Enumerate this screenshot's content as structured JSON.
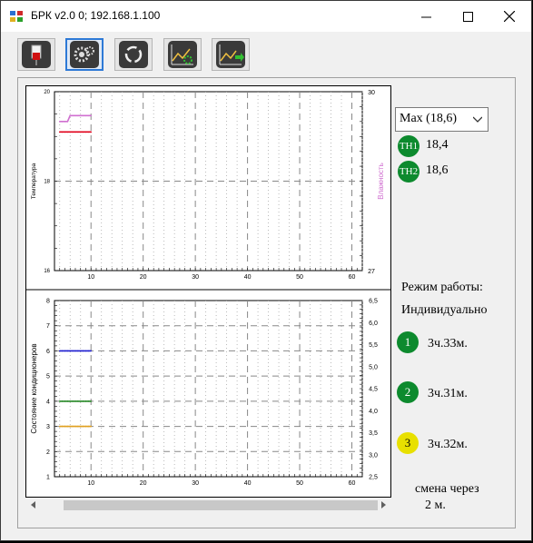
{
  "window": {
    "title": "БРК v2.0 0; 192.168.1.100",
    "controls": [
      "minimize",
      "maximize",
      "close"
    ]
  },
  "toolbar": {
    "buttons": [
      {
        "icon": "device-icon",
        "active": false
      },
      {
        "icon": "gears-icon",
        "active": true
      },
      {
        "icon": "cycle-arrows-icon",
        "active": false
      },
      {
        "icon": "chart-settings-icon",
        "active": false
      },
      {
        "icon": "chart-export-icon",
        "active": false
      }
    ]
  },
  "right_panel": {
    "select": {
      "value": "Max (18,6)"
    },
    "sensors": [
      {
        "badge": "TH1",
        "value": "18,4"
      },
      {
        "badge": "TH2",
        "value": "18,6"
      }
    ],
    "mode_label": "Режим работы:",
    "mode_value": "Индивидуально",
    "units": [
      {
        "num": "1",
        "time": "3ч.33м.",
        "color": "#0d8a2e"
      },
      {
        "num": "2",
        "time": "3ч.31м.",
        "color": "#0d8a2e"
      },
      {
        "num": "3",
        "time": "3ч.32м.",
        "color": "#e8e000"
      }
    ],
    "switch_label": "смена через",
    "switch_value": "2 м."
  },
  "chart_data": [
    {
      "type": "line",
      "ylabel": "Температура",
      "ylabel_right": "Влажность",
      "ylim": [
        16,
        20
      ],
      "ylim_right": [
        27,
        30
      ],
      "xlim": [
        3,
        62
      ],
      "xticks": [
        10,
        20,
        30,
        40,
        50,
        60
      ],
      "yticks_left": [
        "20",
        "18",
        "16"
      ],
      "yticks_right": [
        "30",
        "27"
      ],
      "grid": true,
      "series": [
        {
          "color": "#e0001a",
          "axis": "left",
          "points": [
            [
              4,
              19.1
            ],
            [
              10,
              19.1
            ]
          ]
        },
        {
          "color": "#d070d0",
          "axis": "right",
          "points": [
            [
              4,
              29.5
            ],
            [
              5.5,
              29.5
            ],
            [
              6,
              29.6
            ],
            [
              10,
              29.6
            ]
          ]
        }
      ]
    },
    {
      "type": "line",
      "ylabel": "Состояние кондиционеров",
      "ylim": [
        1,
        8
      ],
      "ylim_right": [
        2.5,
        6.5
      ],
      "xlim": [
        3,
        62
      ],
      "xticks": [
        10,
        20,
        30,
        40,
        50,
        60
      ],
      "yticks_left": [
        "1",
        "2",
        "3",
        "4",
        "5",
        "6",
        "7",
        "8"
      ],
      "yticks_right": [
        "2,5",
        "3,0",
        "3,5",
        "4,0",
        "4,5",
        "5,0",
        "5,5",
        "6,0",
        "6,5"
      ],
      "grid": true,
      "series": [
        {
          "color": "#1f1fd0",
          "axis": "left",
          "points": [
            [
              4,
              6
            ],
            [
              10,
              6
            ]
          ]
        },
        {
          "color": "#2a8a2a",
          "axis": "left",
          "points": [
            [
              4,
              4
            ],
            [
              10,
              4
            ]
          ]
        },
        {
          "color": "#e0a020",
          "axis": "left",
          "points": [
            [
              4,
              3
            ],
            [
              10,
              3
            ]
          ]
        }
      ]
    }
  ]
}
